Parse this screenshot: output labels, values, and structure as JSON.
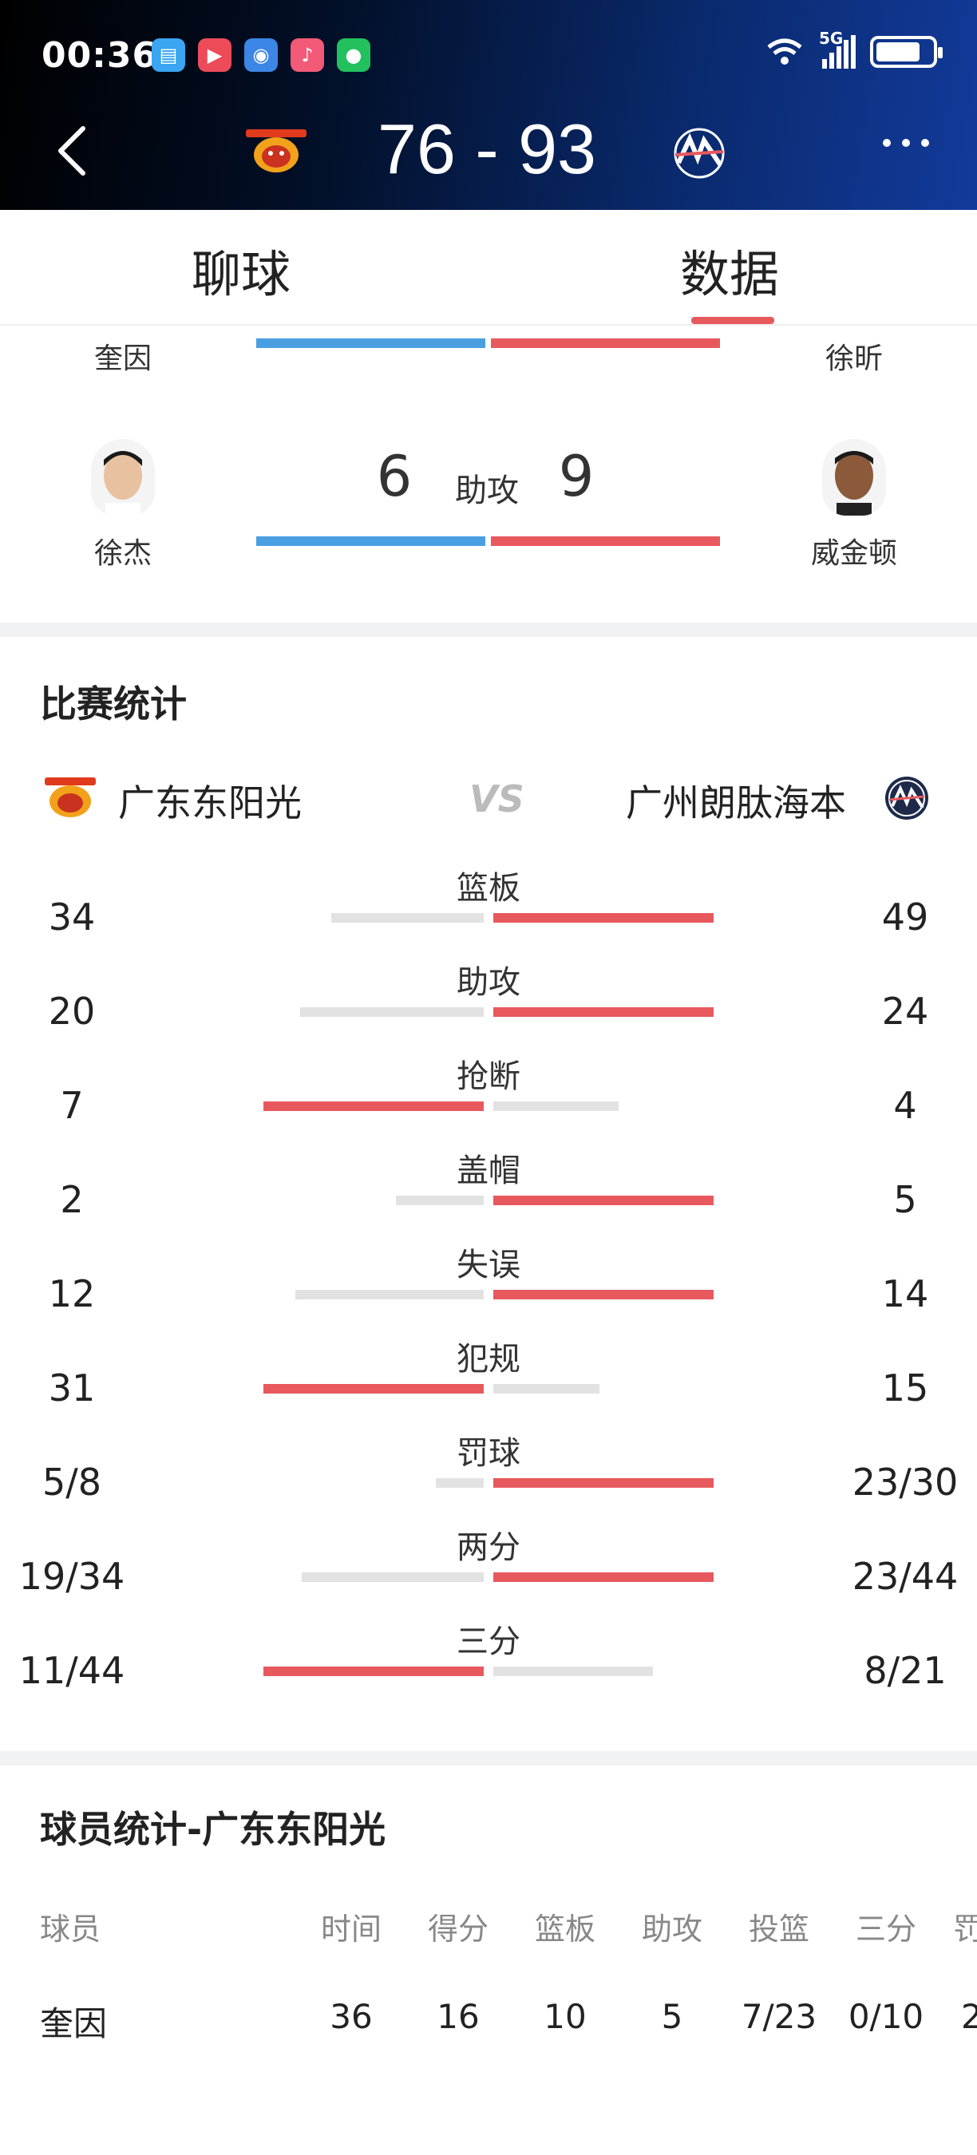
{
  "status_bar": {
    "time": "00:36",
    "network": "5G"
  },
  "header": {
    "score": "76 - 93"
  },
  "tabs": {
    "chat": "聊球",
    "data": "数据"
  },
  "leaders": {
    "top": {
      "home_player": "奎因",
      "away_player": "徐昕"
    },
    "assists": {
      "home_player": "徐杰",
      "home_value": "6",
      "category": "助攻",
      "away_value": "9",
      "away_player": "威金顿"
    }
  },
  "match_stats": {
    "title": "比赛统计",
    "home_team": "广东东阳光",
    "vs": "VS",
    "away_team": "广州朗肽海本",
    "rows": [
      {
        "label": "篮板",
        "home": "34",
        "away": "49"
      },
      {
        "label": "助攻",
        "home": "20",
        "away": "24"
      },
      {
        "label": "抢断",
        "home": "7",
        "away": "4"
      },
      {
        "label": "盖帽",
        "home": "2",
        "away": "5"
      },
      {
        "label": "失误",
        "home": "12",
        "away": "14"
      },
      {
        "label": "犯规",
        "home": "31",
        "away": "15"
      },
      {
        "label": "罚球",
        "home": "5/8",
        "away": "23/30"
      },
      {
        "label": "两分",
        "home": "19/34",
        "away": "23/44"
      },
      {
        "label": "三分",
        "home": "11/44",
        "away": "8/21"
      }
    ]
  },
  "player_stats": {
    "title": "球员统计-广东东阳光",
    "headers": [
      "球员",
      "时间",
      "得分",
      "篮板",
      "助攻",
      "投篮",
      "三分",
      "罚"
    ],
    "rows": [
      [
        "奎因",
        "36",
        "16",
        "10",
        "5",
        "7/23",
        "0/10",
        "2"
      ]
    ]
  },
  "colors": {
    "home_bar": "#4a9fe2",
    "away_bar": "#e8595e",
    "accent": "#e8595e"
  }
}
